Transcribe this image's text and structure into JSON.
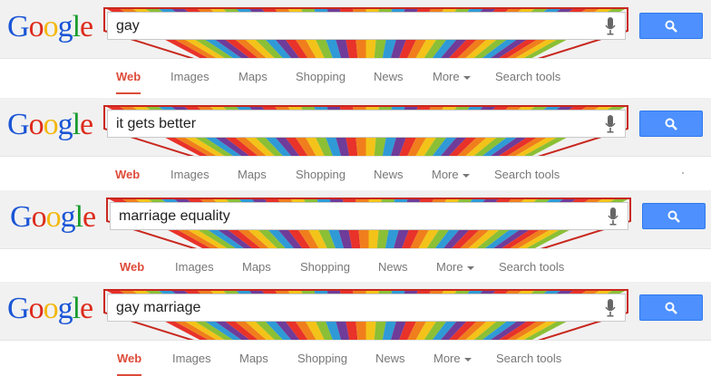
{
  "colors": {
    "rainbow": [
      "#e8322a",
      "#f07e1c",
      "#f3c319",
      "#8bbf35",
      "#2f9ad6",
      "#6f3c99"
    ],
    "search_button": "#4d90fe",
    "active_tab": "#dd4b39"
  },
  "logo": {
    "letters": [
      "G",
      "o",
      "o",
      "g",
      "l",
      "e"
    ],
    "letter_colors": [
      "#1a55d6",
      "#dd2b1c",
      "#f3b80f",
      "#1a55d6",
      "#179c2b",
      "#dd2b1c"
    ]
  },
  "icons": {
    "mic": "microphone-icon",
    "search": "magnifier-icon",
    "more": "caret-down-icon"
  },
  "panels": [
    {
      "query": "gay",
      "tabs": [
        "Web",
        "Images",
        "Maps",
        "Shopping",
        "News",
        "More",
        "Search tools"
      ]
    },
    {
      "query": "it gets better",
      "tabs": [
        "Web",
        "Images",
        "Maps",
        "Shopping",
        "News",
        "More",
        "Search tools"
      ]
    },
    {
      "query": "marriage equality",
      "tabs": [
        "Web",
        "Images",
        "Maps",
        "Shopping",
        "News",
        "More",
        "Search tools"
      ]
    },
    {
      "query": "gay marriage",
      "tabs": [
        "Web",
        "Images",
        "Maps",
        "Shopping",
        "News",
        "More",
        "Search tools"
      ]
    }
  ]
}
